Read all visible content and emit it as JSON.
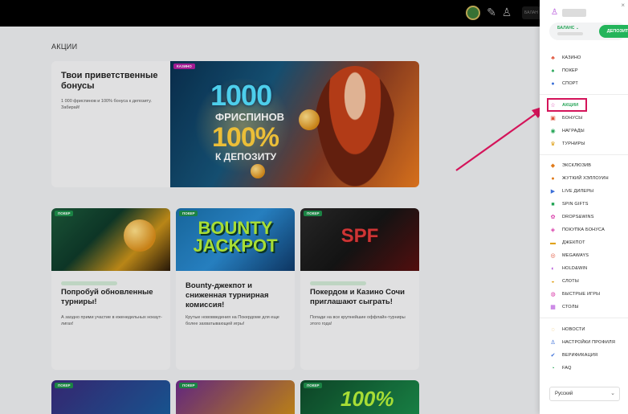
{
  "page": {
    "section_title": "АКЦИИ"
  },
  "hero": {
    "title": "Твои приветственные бонусы",
    "description": "1 000 фриспинов и 100% бонуса к депозиту. Забирай!",
    "tag": "КАЗИНО",
    "banner_line1": "1000",
    "banner_line2": "ФРИСПИНОВ",
    "banner_line3": "100%",
    "banner_line4": "К ДЕПОЗИТУ"
  },
  "cards": [
    {
      "tag": "ПОКЕР",
      "title": "Попробуй обновленные турниры!",
      "description": "А заодно прими участие в еженедельных нокаут-лигах!"
    },
    {
      "tag": "ПОКЕР",
      "banner": "BOUNTY JACKPOT",
      "title": "Bounty-джекпот и сниженная турнирная комиссия!",
      "description": "Крутые нововведения на Покердоме для еще более захватывающей игры!"
    },
    {
      "tag": "ПОКЕР",
      "banner": "SPF",
      "title": "Покердом и Казино Сочи приглашают сыграть!",
      "description": "Попади на все крупнейшие оффлайн-турниры этого года!"
    }
  ],
  "bottom_cards": [
    {
      "tag": "ПОКЕР"
    },
    {
      "tag": "ПОКЕР"
    },
    {
      "tag": "ПОКЕР",
      "banner": "100%"
    }
  ],
  "topbar": {
    "balance_label": "БАЛАН"
  },
  "sidebar": {
    "balance_label": "БАЛАНС",
    "deposit_label": "ДЕПОЗИТ",
    "close_label": "×",
    "group1": [
      {
        "label": "КАЗИНО",
        "icon": "casino-icon",
        "color": "#e0533a"
      },
      {
        "label": "ПОКЕР",
        "icon": "poker-icon",
        "color": "#23a455"
      },
      {
        "label": "СПОРТ",
        "icon": "sport-icon",
        "color": "#3b6fd8"
      }
    ],
    "group2": [
      {
        "label": "АКЦИИ",
        "icon": "star-icon",
        "color": "#d83aa8",
        "active": true
      },
      {
        "label": "БОНУСЫ",
        "icon": "gift-icon",
        "color": "#e0533a"
      },
      {
        "label": "НАГРАДЫ",
        "icon": "medal-icon",
        "color": "#23a455"
      },
      {
        "label": "ТУРНИРЫ",
        "icon": "trophy-icon",
        "color": "#e0a21a"
      }
    ],
    "group3": [
      {
        "label": "ЭКСКЛЮЗИВ",
        "icon": "exclusive-icon",
        "color": "#e07a1a"
      },
      {
        "label": "ЖУТКИЙ ХЭЛЛОУИН",
        "icon": "pumpkin-icon",
        "color": "#e07a1a"
      },
      {
        "label": "LIVE ДИЛЕРЫ",
        "icon": "live-icon",
        "color": "#3b6fd8"
      },
      {
        "label": "SPIN GIFTS",
        "icon": "spin-gift-icon",
        "color": "#23a455"
      },
      {
        "label": "DROPS&WINS",
        "icon": "drops-icon",
        "color": "#d83aa8"
      },
      {
        "label": "ПОКУПКА БОНУСА",
        "icon": "buy-bonus-icon",
        "color": "#d83aa8"
      },
      {
        "label": "ДЖЕКПОТ",
        "icon": "jackpot-icon",
        "color": "#e0a21a"
      },
      {
        "label": "MEGAWAYS",
        "icon": "megaways-icon",
        "color": "#e0533a"
      },
      {
        "label": "HOLD&WIN",
        "icon": "hold-win-icon",
        "color": "#b14ad8"
      },
      {
        "label": "СЛОТЫ",
        "icon": "slots-icon",
        "color": "#e0a21a"
      },
      {
        "label": "БЫСТРЫЕ ИГРЫ",
        "icon": "fast-games-icon",
        "color": "#d83aa8"
      },
      {
        "label": "СТОЛЫ",
        "icon": "tables-icon",
        "color": "#b14ad8"
      }
    ],
    "group4": [
      {
        "label": "НОВОСТИ",
        "icon": "news-icon",
        "color": "#e0a21a"
      },
      {
        "label": "НАСТРОЙКИ ПРОФИЛЯ",
        "icon": "profile-settings-icon",
        "color": "#3b6fd8"
      },
      {
        "label": "ВЕРИФИКАЦИЯ",
        "icon": "verification-icon",
        "color": "#3b6fd8"
      },
      {
        "label": "FAQ",
        "icon": "faq-icon",
        "color": "#23a455"
      }
    ],
    "language": "Русский"
  }
}
